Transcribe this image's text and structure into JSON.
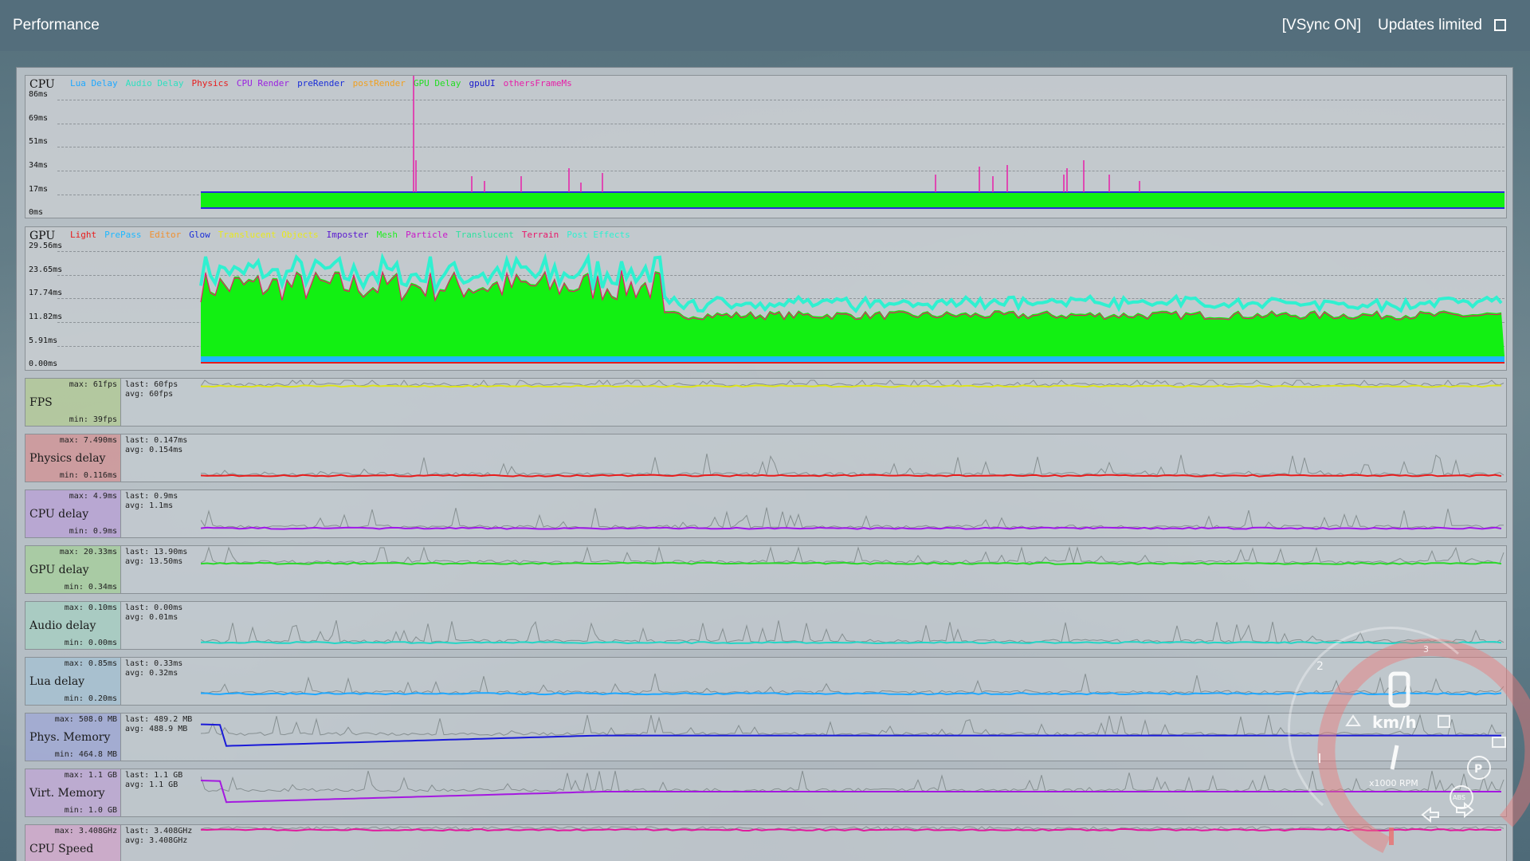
{
  "window": {
    "title": "Performance",
    "vsync_label": "[VSync ON]",
    "updates_label": "Updates limited",
    "updates_checked": false
  },
  "cpu_graph": {
    "title": "CPU",
    "y_ticks": [
      "86ms",
      "69ms",
      "51ms",
      "34ms",
      "17ms",
      "0ms"
    ],
    "legend": [
      {
        "name": "Lua Delay",
        "color": "#1fa8ff"
      },
      {
        "name": "Audio Delay",
        "color": "#2fe0c0"
      },
      {
        "name": "Physics",
        "color": "#e81c1c"
      },
      {
        "name": "CPU Render",
        "color": "#9a22e0"
      },
      {
        "name": "preRender",
        "color": "#1a2ed8"
      },
      {
        "name": "postRender",
        "color": "#f0a020"
      },
      {
        "name": "GPU Delay",
        "color": "#22dd22"
      },
      {
        "name": "gpuUI",
        "color": "#1818cc"
      },
      {
        "name": "othersFrameMs",
        "color": "#e61ea8"
      }
    ]
  },
  "gpu_graph": {
    "title": "GPU",
    "y_ticks": [
      "29.56ms",
      "23.65ms",
      "17.74ms",
      "11.82ms",
      "5.91ms",
      "0.00ms"
    ],
    "legend": [
      {
        "name": "Light",
        "color": "#e81c1c"
      },
      {
        "name": "PrePass",
        "color": "#1fb8ff"
      },
      {
        "name": "Editor",
        "color": "#f09030"
      },
      {
        "name": "Glow",
        "color": "#1a2ed8"
      },
      {
        "name": "Translucent Objects",
        "color": "#e8e820"
      },
      {
        "name": "Imposter",
        "color": "#5a18d0"
      },
      {
        "name": "Mesh",
        "color": "#22ee22"
      },
      {
        "name": "Particle",
        "color": "#c818c8"
      },
      {
        "name": "Translucent",
        "color": "#30e0a0"
      },
      {
        "name": "Terrain",
        "color": "#e8186a"
      },
      {
        "name": "Post Effects",
        "color": "#30f0d0"
      }
    ]
  },
  "metrics": [
    {
      "id": "fps",
      "name": "FPS",
      "max": "max: 61fps",
      "min": "min: 39fps",
      "last": "last: 60fps",
      "avg": "avg: 60fps",
      "bg": "rgba(168,198,120,0.55)",
      "color": "#dde41c",
      "level": 0.93
    },
    {
      "id": "physics",
      "name": "Physics delay",
      "max": "max: 7.490ms",
      "min": "min: 0.116ms",
      "last": "last: 0.147ms",
      "avg": "avg: 0.154ms",
      "bg": "rgba(214,120,120,0.55)",
      "color": "#e81c1c",
      "level": 0.07
    },
    {
      "id": "cpu",
      "name": "CPU delay",
      "max": "max: 4.9ms",
      "min": "min: 0.9ms",
      "last": "last: 0.9ms",
      "avg": "avg: 1.1ms",
      "bg": "rgba(176,140,214,0.55)",
      "color": "#a018e8",
      "level": 0.15
    },
    {
      "id": "gpu",
      "name": "GPU delay",
      "max": "max: 20.33ms",
      "min": "min: 0.34ms",
      "last": "last: 13.90ms",
      "avg": "avg: 13.50ms",
      "bg": "rgba(150,206,130,0.55)",
      "color": "#2ad82a",
      "level": 0.68
    },
    {
      "id": "audio",
      "name": "Audio delay",
      "max": "max: 0.10ms",
      "min": "min: 0.00ms",
      "last": "last: 0.00ms",
      "avg": "avg: 0.01ms",
      "bg": "rgba(150,206,186,0.55)",
      "color": "#22d6c6",
      "level": 0.08
    },
    {
      "id": "lua",
      "name": "Lua delay",
      "max": "max: 0.85ms",
      "min": "min: 0.20ms",
      "last": "last: 0.33ms",
      "avg": "avg: 0.32ms",
      "bg": "rgba(150,186,210,0.55)",
      "color": "#1fa8ff",
      "level": 0.2
    },
    {
      "id": "physmem",
      "name": "Phys. Memory",
      "max": "max: 508.0 MB",
      "min": "min: 464.8 MB",
      "last": "last: 489.2 MB",
      "avg": "avg: 488.9 MB",
      "bg": "rgba(140,150,214,0.55)",
      "color": "#1a1ad8",
      "level": 0.56
    },
    {
      "id": "virtmem",
      "name": "Virt. Memory",
      "max": "max: 1.1 GB",
      "min": "min: 1.0 GB",
      "last": "last: 1.1 GB",
      "avg": "avg: 1.1 GB",
      "bg": "rgba(186,150,214,0.55)",
      "color": "#a418e0",
      "level": 0.55
    },
    {
      "id": "cpuspeed",
      "name": "CPU Speed",
      "max": "max: 3.408GHz",
      "min": "",
      "last": "last: 3.408GHz",
      "avg": "avg: 3.408GHz",
      "bg": "rgba(214,150,200,0.55)",
      "color": "#e0189c",
      "level": 1.0
    }
  ],
  "hud": {
    "speed_unit": "km/h",
    "rpm_label": "x1000 RPM",
    "gear_marks": [
      "2",
      "3"
    ],
    "abs_label": "ABS",
    "park_label": "P"
  }
}
